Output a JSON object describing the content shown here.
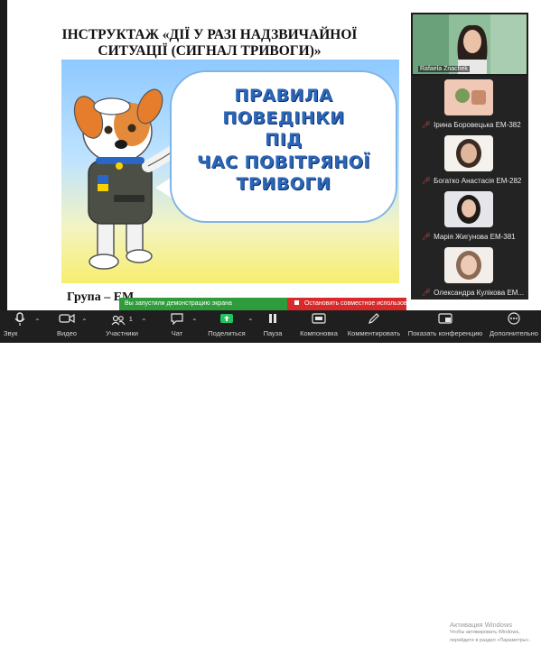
{
  "slide": {
    "title": "ІНСТРУКТАЖ «ДІЇ У РАЗІ НАДЗВИЧАЙНОЇ\nСИТУАЦІЇ (СИГНАЛ ТРИВОГИ)»",
    "banner_text": "ПРАВИЛА\nПОВЕДІНКИ\nПІД\nЧАС ПОВІТРЯНОЇ\nТРИВОГИ",
    "footer_label": "Група – ЕМ"
  },
  "gallery": {
    "speaker": {
      "name": "Rafaela Znachek"
    },
    "participants": [
      {
        "name": "Ірина Боровецька ЕМ-382"
      },
      {
        "name": "Богатко Анастасія ЕМ-282"
      },
      {
        "name": "Марія Жигунова ЕМ-381"
      },
      {
        "name": "Олександра Кулікова ЕМ..."
      }
    ]
  },
  "share_bar": {
    "status": "Вы запустили демонстрацию экрана",
    "stop": "Остановить совместное использование"
  },
  "toolbar": {
    "items": [
      {
        "label": "Звук",
        "icon": "microphone-icon"
      },
      {
        "label": "Видео",
        "icon": "video-camera-icon"
      },
      {
        "label": "Участники",
        "icon": "participants-icon",
        "count": "1"
      },
      {
        "label": "Чат",
        "icon": "chat-icon"
      },
      {
        "label": "Поделиться",
        "icon": "share-screen-icon"
      },
      {
        "label": "Пауза",
        "icon": "pause-icon"
      },
      {
        "label": "Компоновка",
        "icon": "layout-icon"
      },
      {
        "label": "Комментировать",
        "icon": "annotate-icon"
      },
      {
        "label": "Показать конференцию",
        "icon": "show-meeting-icon"
      },
      {
        "label": "Дополнительно",
        "icon": "more-icon"
      }
    ],
    "watermark_title": "Активация Windows",
    "watermark_sub": "Чтобы активировать Windows, перейдите в раздел «Параметры»."
  },
  "colors": {
    "share_green": "#2e9c3a",
    "stop_red": "#d82a2a",
    "banner_text_blue": "#2b66b8",
    "share_icon_green": "#22c35e"
  }
}
